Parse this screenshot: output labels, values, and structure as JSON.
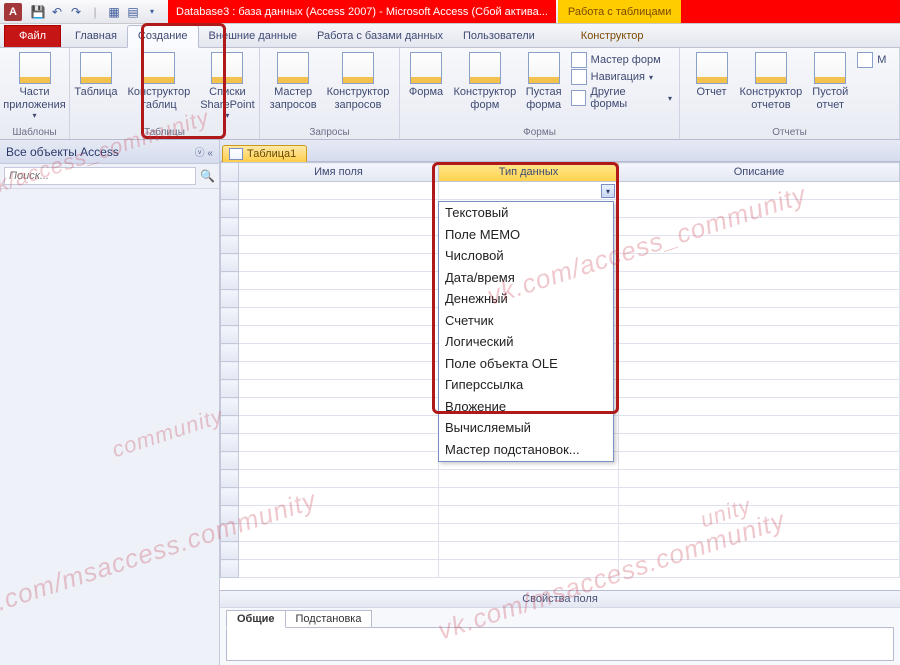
{
  "title": {
    "red_segment": "Database3 : база данных (Access 2007)  -  Microsoft Access (Сбой актива...",
    "context_tab": "Работа с таблицами"
  },
  "tabs": {
    "file": "Файл",
    "items": [
      "Главная",
      "Создание",
      "Внешние данные",
      "Работа с базами данных",
      "Пользователи",
      "Конструктор"
    ],
    "active": "Создание"
  },
  "ribbon": {
    "groups": {
      "templates": {
        "label": "Шаблоны",
        "btn": "Части\nприложения"
      },
      "tables": {
        "label": "Таблицы",
        "btn1": "Таблица",
        "btn2": "Конструктор\nтаблиц",
        "btn3": "Списки\nSharePoint"
      },
      "queries": {
        "label": "Запросы",
        "btn1": "Мастер\nзапросов",
        "btn2": "Конструктор\nзапросов"
      },
      "forms": {
        "label": "Формы",
        "btn1": "Форма",
        "btn2": "Конструктор\nформ",
        "btn3": "Пустая\nформа",
        "small1": "Мастер форм",
        "small2": "Навигация",
        "small3": "Другие формы"
      },
      "reports": {
        "label": "Отчеты",
        "btn1": "Отчет",
        "btn2": "Конструктор\nотчетов",
        "btn3": "Пустой\nотчет",
        "small1": "М"
      }
    }
  },
  "nav": {
    "header": "Все объекты Access",
    "search_placeholder": "Поиск..."
  },
  "doc_tab": "Таблица1",
  "design_columns": {
    "rowhdr": "",
    "field_name": "Имя поля",
    "data_type": "Тип данных",
    "description": "Описание"
  },
  "data_type_options": [
    "Текстовый",
    "Поле МЕМО",
    "Числовой",
    "Дата/время",
    "Денежный",
    "Счетчик",
    "Логический",
    "Поле объекта OLE",
    "Гиперссылка",
    "Вложение",
    "Вычисляемый",
    "Мастер подстановок..."
  ],
  "field_props": {
    "title": "Свойства поля",
    "tab_general": "Общие",
    "tab_lookup": "Подстановка"
  },
  "watermarks": [
    "ok.com/msaccess.community",
    "vk.com/access_community",
    "vk.com/msaccess.community",
    "vk/access_community"
  ]
}
